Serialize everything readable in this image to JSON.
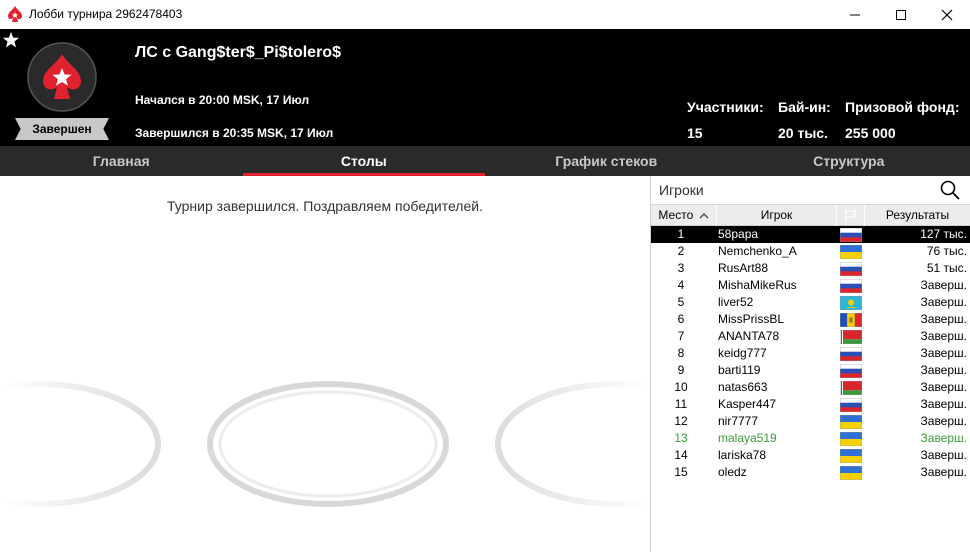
{
  "window": {
    "title": "Лобби турнира 2962478403"
  },
  "header": {
    "tournament_name": "ЛС с Gang$ter$_Pi$tolero$",
    "started": "Начался в 20:00 MSK, 17 Июл",
    "finished": "Завершился в 20:35 MSK, 17 Июл",
    "status": "Завершен",
    "stats": {
      "players_label": "Участники:",
      "players_value": "15",
      "buyin_label": "Бай-ин:",
      "buyin_value": "20 тыс.",
      "prize_label": "Призовой фонд:",
      "prize_value": "255 000"
    }
  },
  "tabs": [
    {
      "label": "Главная",
      "active": false
    },
    {
      "label": "Столы",
      "active": true
    },
    {
      "label": "График стеков",
      "active": false
    },
    {
      "label": "Структура",
      "active": false
    }
  ],
  "main": {
    "message": "Турнир завершился. Поздравляем победителей."
  },
  "players_panel": {
    "title": "Игроки",
    "columns": {
      "place": "Место",
      "player": "Игрок",
      "results": "Результаты"
    },
    "rows": [
      {
        "place": "1",
        "name": "58papa",
        "flag": "ru",
        "result": "127 тыс.",
        "selected": true
      },
      {
        "place": "2",
        "name": "Nemchenko_A",
        "flag": "ua",
        "result": "76 тыс."
      },
      {
        "place": "3",
        "name": "RusArt88",
        "flag": "ru",
        "result": "51 тыс."
      },
      {
        "place": "4",
        "name": "MishaMikeRus",
        "flag": "ru",
        "result": "Заверш."
      },
      {
        "place": "5",
        "name": "liver52",
        "flag": "kz",
        "result": "Заверш."
      },
      {
        "place": "6",
        "name": "MissPrissBL",
        "flag": "md",
        "result": "Заверш."
      },
      {
        "place": "7",
        "name": "ANANTA78",
        "flag": "by",
        "result": "Заверш."
      },
      {
        "place": "8",
        "name": "keidg777",
        "flag": "ru",
        "result": "Заверш."
      },
      {
        "place": "9",
        "name": "barti119",
        "flag": "ru",
        "result": "Заверш."
      },
      {
        "place": "10",
        "name": "natas663",
        "flag": "by",
        "result": "Заверш."
      },
      {
        "place": "11",
        "name": "Kasper447",
        "flag": "ru",
        "result": "Заверш."
      },
      {
        "place": "12",
        "name": "nir7777",
        "flag": "ua",
        "result": "Заверш."
      },
      {
        "place": "13",
        "name": "malaya519",
        "flag": "ua",
        "result": "Заверш.",
        "highlight": true
      },
      {
        "place": "14",
        "name": "lariska78",
        "flag": "ua",
        "result": "Заверш."
      },
      {
        "place": "15",
        "name": "oledz",
        "flag": "ua",
        "result": "Заверш."
      }
    ]
  },
  "colors": {
    "accent": "#e0222f",
    "highlight_text": "#3b9a3b",
    "header_bg": "#000000",
    "tab_bg": "#2a2a2a"
  },
  "icons": [
    "pokerstars-icon",
    "minimize-icon",
    "maximize-icon",
    "close-icon",
    "favorite-star-icon",
    "spade-logo-icon",
    "search-icon",
    "sort-asc-icon",
    "flag-column-icon"
  ]
}
